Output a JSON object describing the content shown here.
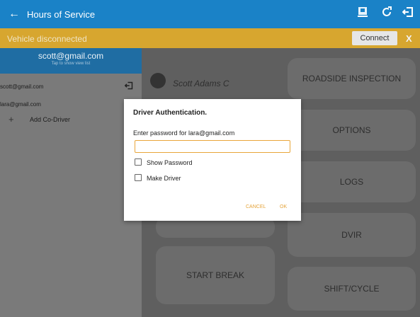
{
  "appbar": {
    "title": "Hours of Service",
    "back_icon": "←",
    "icons": [
      "report-icon",
      "refresh-icon",
      "logout-icon"
    ]
  },
  "banner": {
    "message": "Vehicle disconnected",
    "connect": "Connect",
    "close": "X"
  },
  "drawer": {
    "email": "scott@gmail.com",
    "hint": "Tap to show view list",
    "users": [
      "scott@gmail.com",
      "lara@gmail.com"
    ],
    "add": "Add Co-Driver"
  },
  "main": {
    "user": "Scott Adams C",
    "tiles": [
      "ROADSIDE INSPECTION",
      "OPTIONS",
      "LOGS",
      "DVIR",
      "START BREAK",
      "SHIFT/CYCLE"
    ]
  },
  "dialog": {
    "title": "Driver Authentication.",
    "prompt": "Enter password for lara@gmail.com",
    "show_password": "Show Password",
    "make_driver": "Make Driver",
    "cancel": "CANCEL",
    "ok": "OK"
  }
}
